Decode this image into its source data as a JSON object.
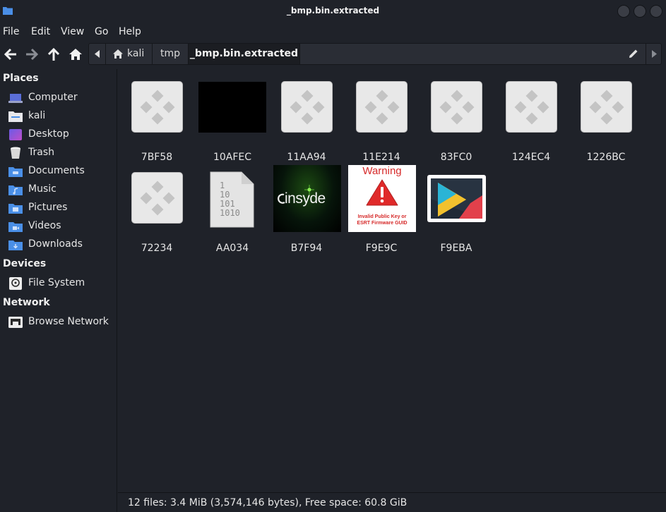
{
  "window": {
    "title": "_bmp.bin.extracted"
  },
  "menu": [
    "File",
    "Edit",
    "View",
    "Go",
    "Help"
  ],
  "path": {
    "crumbs": [
      "kali",
      "tmp",
      "_bmp.bin.extracted"
    ]
  },
  "sidebar": {
    "places_heading": "Places",
    "places": [
      {
        "label": "Computer",
        "icon": "computer-icon"
      },
      {
        "label": "kali",
        "icon": "home-folder-icon"
      },
      {
        "label": "Desktop",
        "icon": "desktop-icon"
      },
      {
        "label": "Trash",
        "icon": "trash-icon"
      },
      {
        "label": "Documents",
        "icon": "documents-folder-icon"
      },
      {
        "label": "Music",
        "icon": "music-folder-icon"
      },
      {
        "label": "Pictures",
        "icon": "pictures-folder-icon"
      },
      {
        "label": "Videos",
        "icon": "videos-folder-icon"
      },
      {
        "label": "Downloads",
        "icon": "downloads-folder-icon"
      }
    ],
    "devices_heading": "Devices",
    "devices": [
      {
        "label": "File System",
        "icon": "drive-icon"
      }
    ],
    "network_heading": "Network",
    "network": [
      {
        "label": "Browse Network",
        "icon": "network-icon"
      }
    ]
  },
  "files": [
    {
      "name": "7BF58",
      "thumb": "image-placeholder-icon"
    },
    {
      "name": "10AFEC",
      "thumb": "black-image"
    },
    {
      "name": "11AA94",
      "thumb": "image-placeholder-icon"
    },
    {
      "name": "11E214",
      "thumb": "image-placeholder-icon"
    },
    {
      "name": "83FC0",
      "thumb": "image-placeholder-icon"
    },
    {
      "name": "124EC4",
      "thumb": "image-placeholder-icon"
    },
    {
      "name": "1226BC",
      "thumb": "image-placeholder-icon"
    },
    {
      "name": "72234",
      "thumb": "image-placeholder-icon"
    },
    {
      "name": "AA034",
      "thumb": "binary-file-icon",
      "binary_lines": [
        "1",
        "10",
        "101",
        "1010"
      ]
    },
    {
      "name": "B7F94",
      "thumb": "insyde-logo-image",
      "logo_text": "insyde"
    },
    {
      "name": "F9E9C",
      "thumb": "warning-image",
      "warning_title": "Warning",
      "warning_lines": [
        "Invalid Public Key or",
        "ESRT Firmware GUID"
      ]
    },
    {
      "name": "F9EBA",
      "thumb": "play-logo-image"
    }
  ],
  "status": {
    "text": "12 files: 3.4 MiB (3,574,146 bytes), Free space: 60.8 GiB"
  },
  "colors": {
    "background": "#1f2229",
    "folder_blue": "#4a8fe7",
    "warning_red": "#e02a2a"
  }
}
